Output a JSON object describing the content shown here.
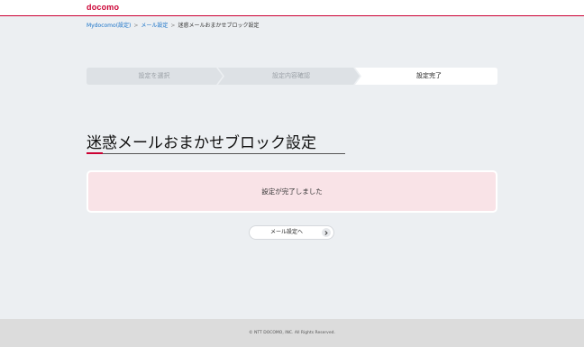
{
  "header": {
    "logo_text": "docomo"
  },
  "breadcrumb": {
    "items": [
      "Mydocomo(設定)",
      "メール設定"
    ],
    "separator": ">",
    "current": "迷惑メールおまかせブロック設定"
  },
  "steps": {
    "items": [
      "設定を選択",
      "設定内容確認",
      "設定完了"
    ],
    "active_index": 2
  },
  "page": {
    "title": "迷惑メールおまかせブロック設定"
  },
  "message": {
    "text": "設定が完了しました"
  },
  "actions": {
    "mail_settings_button": "メール設定へ",
    "icon": "chevron-right-icon"
  },
  "footer": {
    "copyright": "© NTT DOCOMO, INC. All Rights Reserved."
  },
  "colors": {
    "brand": "#cc0033",
    "link": "#1a73c8",
    "background": "#eceff2",
    "message_bg": "#f9e3e7"
  }
}
